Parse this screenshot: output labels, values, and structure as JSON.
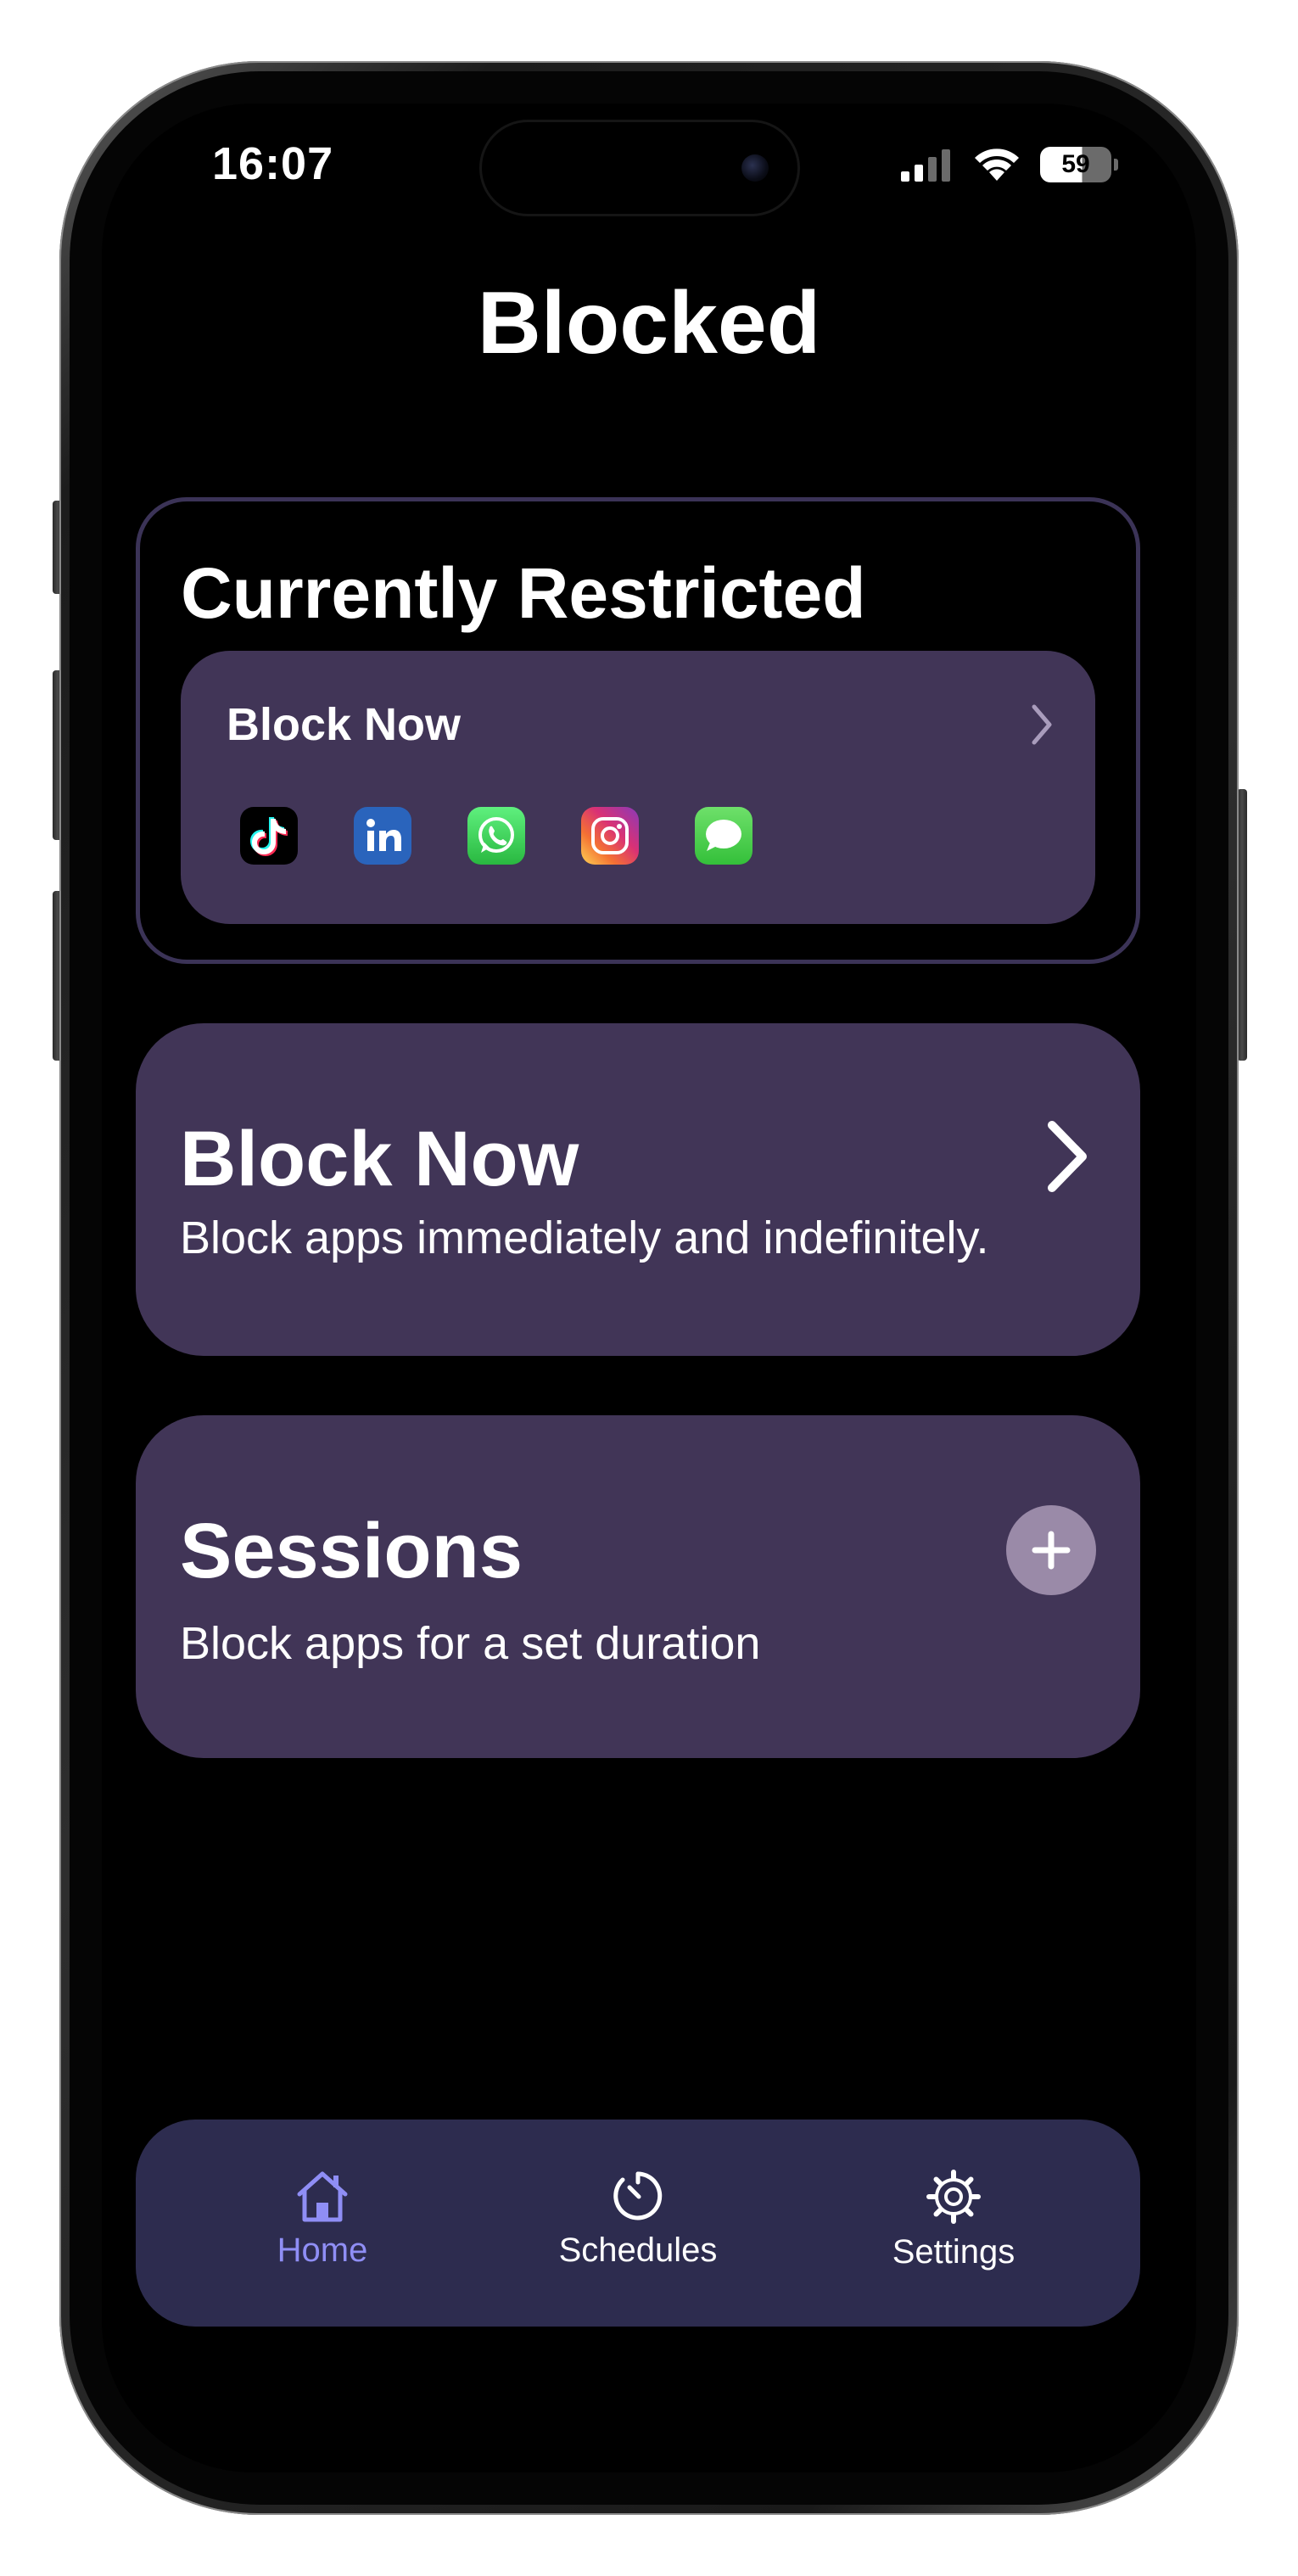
{
  "status_bar": {
    "time": "16:07",
    "battery": "59"
  },
  "title": "Blocked",
  "currently_restricted": {
    "title": "Currently Restricted",
    "item": {
      "title": "Block Now",
      "apps": [
        "tiktok-icon",
        "linkedin-icon",
        "whatsapp-icon",
        "instagram-icon",
        "messages-icon"
      ]
    }
  },
  "block_now": {
    "title": "Block Now",
    "subtitle": "Block apps immediately and indefinitely."
  },
  "sessions": {
    "title": "Sessions",
    "subtitle": "Block apps for a set duration"
  },
  "tabs": [
    {
      "label": "Home",
      "icon": "house-icon",
      "active": true
    },
    {
      "label": "Schedules",
      "icon": "timer-icon",
      "active": false
    },
    {
      "label": "Settings",
      "icon": "gear-icon",
      "active": false
    }
  ],
  "colors": {
    "card": "#413557",
    "card_border": "#3b3357",
    "tabbar": "#2d2c4f",
    "active_tab": "#8f8ef5",
    "plus_button": "#9a8aa8"
  }
}
